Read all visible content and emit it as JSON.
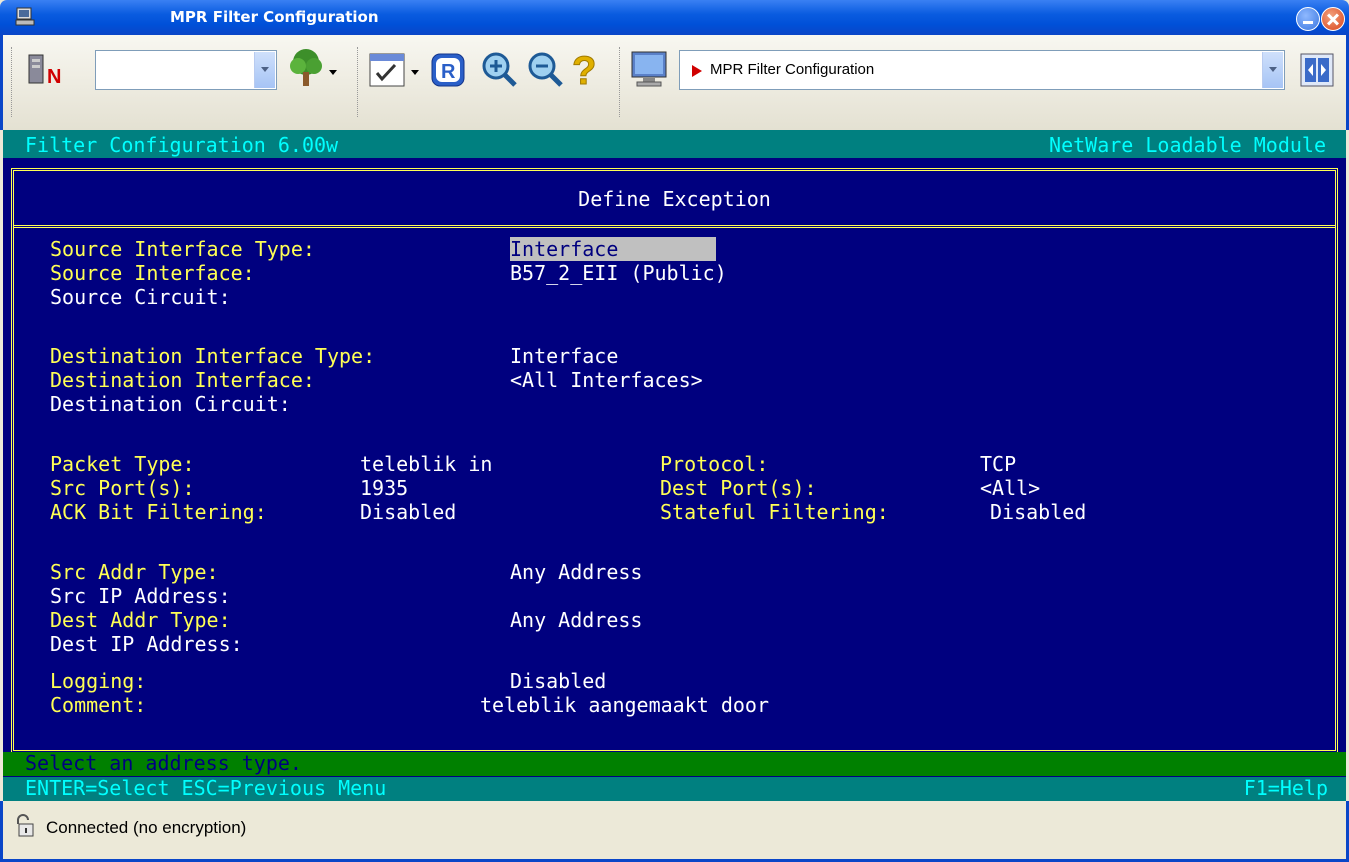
{
  "window": {
    "title": "MPR Filter Configuration"
  },
  "toolbar": {
    "connection_combo_value": "",
    "session_combo_value": "MPR Filter Configuration",
    "icons": [
      "novell-server-icon",
      "tree-icon",
      "script-icon",
      "record-icon",
      "zoom-in-icon",
      "zoom-out-icon",
      "help-icon",
      "monitor-icon",
      "toggle-panel-icon"
    ]
  },
  "terminal": {
    "header_left": "Filter Configuration  6.00w",
    "header_right": "NetWare Loadable Module",
    "box_title": "Define Exception",
    "fields": {
      "src_iface_type_label": "Source Interface Type:",
      "src_iface_type_value": "Interface",
      "src_iface_label": "Source Interface:",
      "src_iface_value": "B57_2_EII (Public)",
      "src_circuit_label": "Source Circuit:",
      "dst_iface_type_label": "Destination Interface Type:",
      "dst_iface_type_value": "Interface",
      "dst_iface_label": "Destination Interface:",
      "dst_iface_value": "<All Interfaces>",
      "dst_circuit_label": "Destination Circuit:",
      "packet_type_label": "Packet Type:",
      "packet_type_value": "teleblik in",
      "protocol_label": "Protocol:",
      "protocol_value": "TCP",
      "src_ports_label": "Src Port(s):",
      "src_ports_value": "1935",
      "dest_ports_label": "Dest Port(s):",
      "dest_ports_value": "<All>",
      "ack_label": "ACK Bit Filtering:",
      "ack_value": "Disabled",
      "stateful_label": "Stateful Filtering:",
      "stateful_value": "Disabled",
      "src_addr_type_label": "Src Addr Type:",
      "src_addr_type_value": "Any Address",
      "src_ip_label": "Src IP Address:",
      "dest_addr_type_label": "Dest Addr Type:",
      "dest_addr_type_value": "Any Address",
      "dest_ip_label": "Dest IP Address:",
      "logging_label": "Logging:",
      "logging_value": "Disabled",
      "comment_label": "Comment:",
      "comment_value": "teleblik aangemaakt door"
    },
    "status_line": "Select an address type.",
    "keys_left": "ENTER=Select  ESC=Previous Menu",
    "keys_right": "F1=Help"
  },
  "statusbar": {
    "text": "Connected (no encryption)"
  },
  "colors": {
    "terminal_bg": "#00007f",
    "label_yellow": "#ffff54",
    "value_white": "#ffffff",
    "header_teal": "#008080",
    "status_green": "#008000"
  }
}
